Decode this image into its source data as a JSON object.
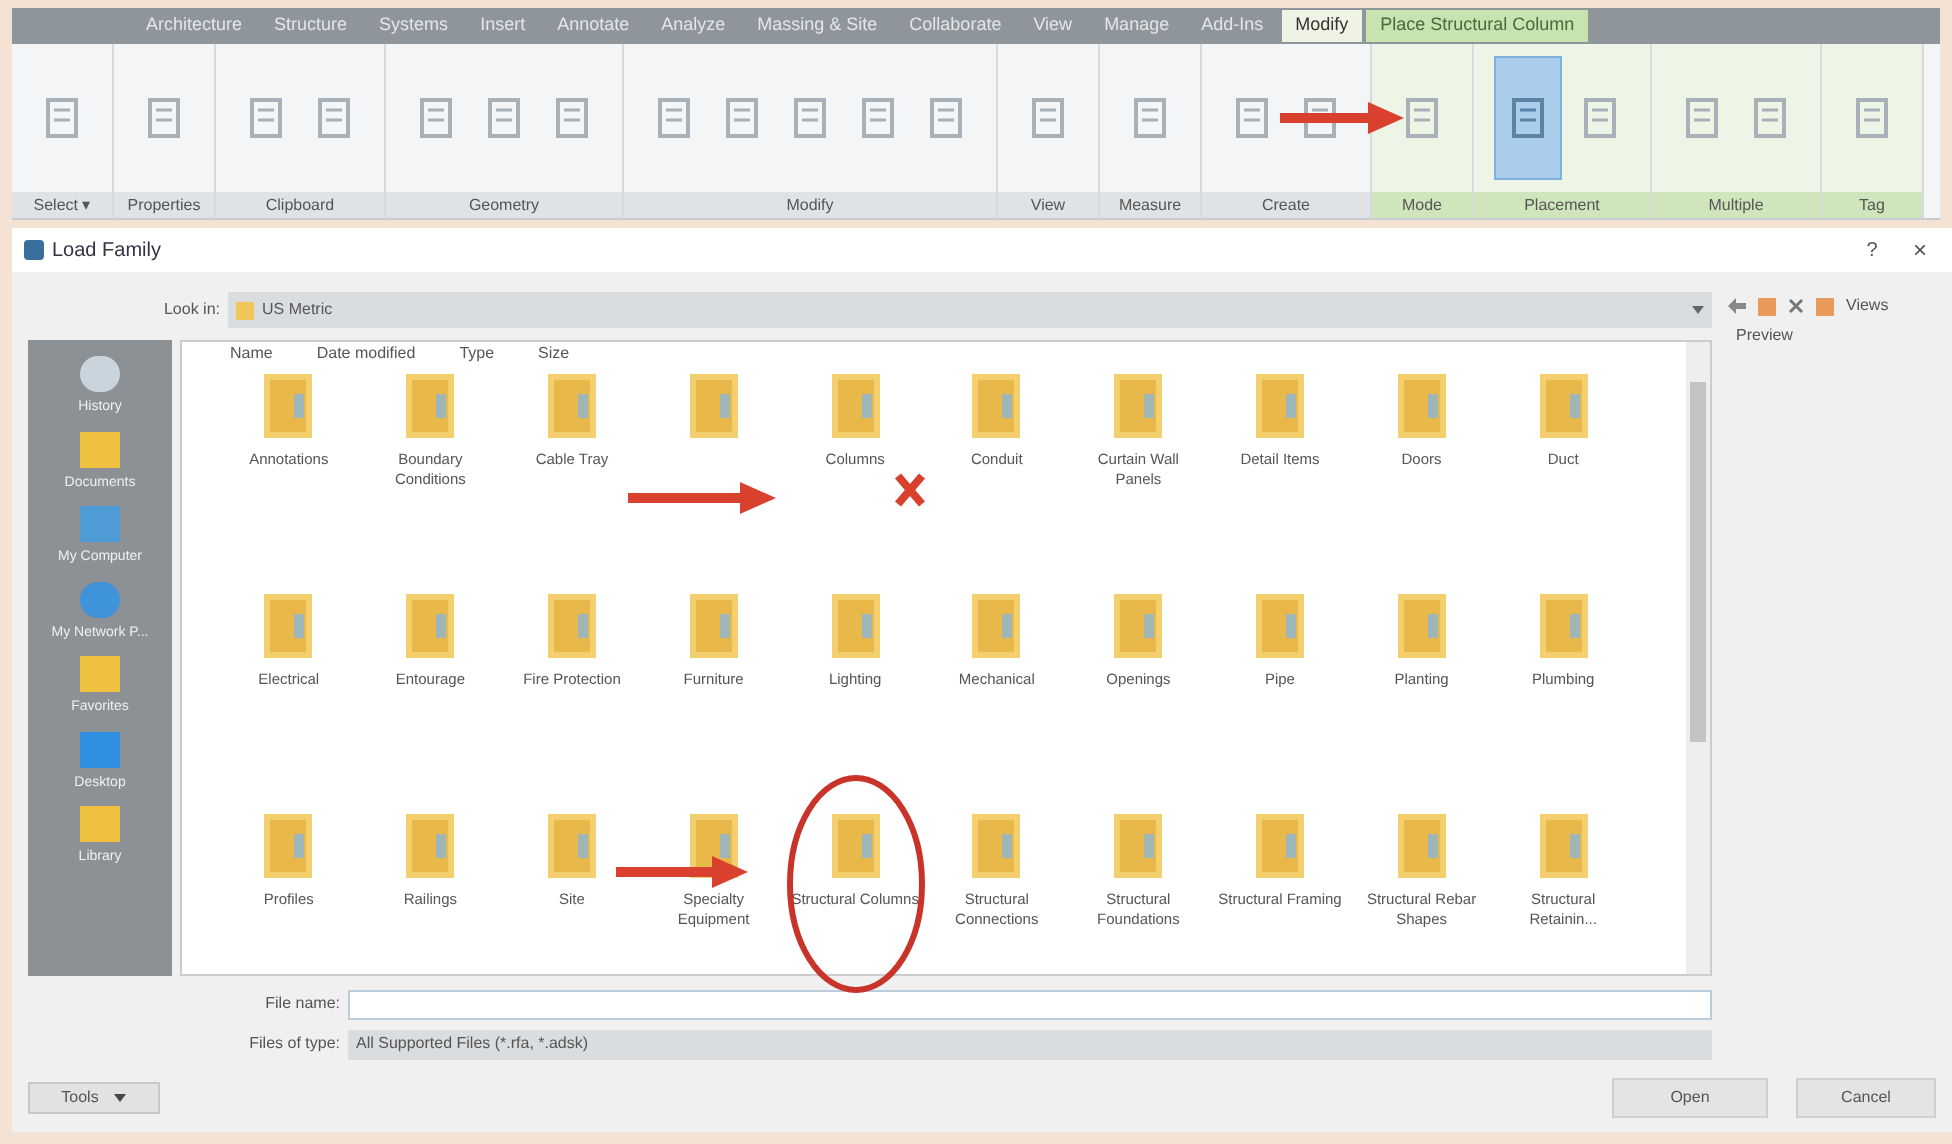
{
  "ribbon": {
    "tabs": [
      {
        "label": "Architecture",
        "selected": false,
        "kind": "normal"
      },
      {
        "label": "Structure",
        "selected": false,
        "kind": "normal"
      },
      {
        "label": "Systems",
        "selected": false,
        "kind": "normal"
      },
      {
        "label": "Insert",
        "selected": false,
        "kind": "normal"
      },
      {
        "label": "Annotate",
        "selected": false,
        "kind": "normal"
      },
      {
        "label": "Analyze",
        "selected": false,
        "kind": "normal"
      },
      {
        "label": "Massing & Site",
        "selected": false,
        "kind": "normal"
      },
      {
        "label": "Collaborate",
        "selected": false,
        "kind": "normal"
      },
      {
        "label": "View",
        "selected": false,
        "kind": "normal"
      },
      {
        "label": "Manage",
        "selected": false,
        "kind": "normal"
      },
      {
        "label": "Add-Ins",
        "selected": false,
        "kind": "normal"
      },
      {
        "label": "Modify",
        "selected": true,
        "kind": "contextual"
      },
      {
        "label": "Place Structural Column",
        "selected": false,
        "kind": "contextual"
      }
    ],
    "panels": [
      {
        "label": "Select ▾",
        "tools": [
          {
            "selected": false
          }
        ]
      },
      {
        "label": "Properties",
        "tools": [
          {
            "selected": false
          }
        ]
      },
      {
        "label": "Clipboard",
        "tools": [
          {
            "selected": false
          },
          {
            "selected": false
          }
        ]
      },
      {
        "label": "Geometry",
        "tools": [
          {
            "selected": false
          },
          {
            "selected": false
          },
          {
            "selected": false
          }
        ]
      },
      {
        "label": "Modify",
        "tools": [
          {
            "selected": false
          },
          {
            "selected": false
          },
          {
            "selected": false
          },
          {
            "selected": false
          },
          {
            "selected": false
          }
        ]
      },
      {
        "label": "View",
        "tools": [
          {
            "selected": false
          }
        ]
      },
      {
        "label": "Measure",
        "tools": [
          {
            "selected": false
          }
        ]
      },
      {
        "label": "Create",
        "tools": [
          {
            "selected": false
          },
          {
            "selected": false
          }
        ]
      },
      {
        "label": "Mode",
        "tools": [
          {
            "selected": false
          }
        ]
      },
      {
        "label": "Placement",
        "tools": [
          {
            "selected": true
          },
          {
            "selected": false
          }
        ]
      },
      {
        "label": "Multiple",
        "tools": [
          {
            "selected": false
          },
          {
            "selected": false
          }
        ]
      },
      {
        "label": "Tag",
        "tools": [
          {
            "selected": false
          }
        ]
      }
    ]
  },
  "dialog": {
    "title": "Load Family",
    "help": "?",
    "close": "×",
    "look_in": {
      "label": "Look in:",
      "value": "US Metric"
    },
    "toolbar": {
      "views": "Views",
      "preview": "Preview"
    },
    "places": [
      "History",
      "Documents",
      "My Computer",
      "My Network P...",
      "Favorites",
      "Desktop",
      "Library"
    ],
    "columns": [
      "Name",
      "Date modified",
      "Type",
      "Size"
    ],
    "folders": [
      {
        "label": "Annotations"
      },
      {
        "label": "Boundary Conditions"
      },
      {
        "label": "Cable Tray"
      },
      {
        "covered": true
      },
      {
        "label": "Columns"
      },
      {
        "label": "Conduit"
      },
      {
        "label": "Curtain Wall Panels"
      },
      {
        "label": "Detail Items"
      },
      {
        "label": "Doors"
      },
      {
        "label": "Duct"
      },
      {
        "label": "Electrical"
      },
      {
        "label": "Entourage"
      },
      {
        "label": "Fire Protection"
      },
      {
        "label": "Furniture"
      },
      {
        "label": "Lighting"
      },
      {
        "label": "Mechanical"
      },
      {
        "label": "Openings"
      },
      {
        "label": "Pipe"
      },
      {
        "label": "Planting"
      },
      {
        "label": "Plumbing"
      },
      {
        "label": "Profiles"
      },
      {
        "label": "Railings"
      },
      {
        "label": "Site"
      },
      {
        "label": "Specialty Equipment"
      },
      {
        "label": "Structural Columns"
      },
      {
        "label": "Structural Connections"
      },
      {
        "label": "Structural Foundations"
      },
      {
        "label": "Structural Framing"
      },
      {
        "label": "Structural Rebar Shapes"
      },
      {
        "label": "Structural Retainin..."
      }
    ],
    "file_name": {
      "label": "File name:"
    },
    "file_type": {
      "label": "Files of type:",
      "value": "All Supported Files (*.rfa, *.adsk)"
    },
    "tools": "Tools",
    "open": "Open",
    "cancel": "Cancel"
  }
}
